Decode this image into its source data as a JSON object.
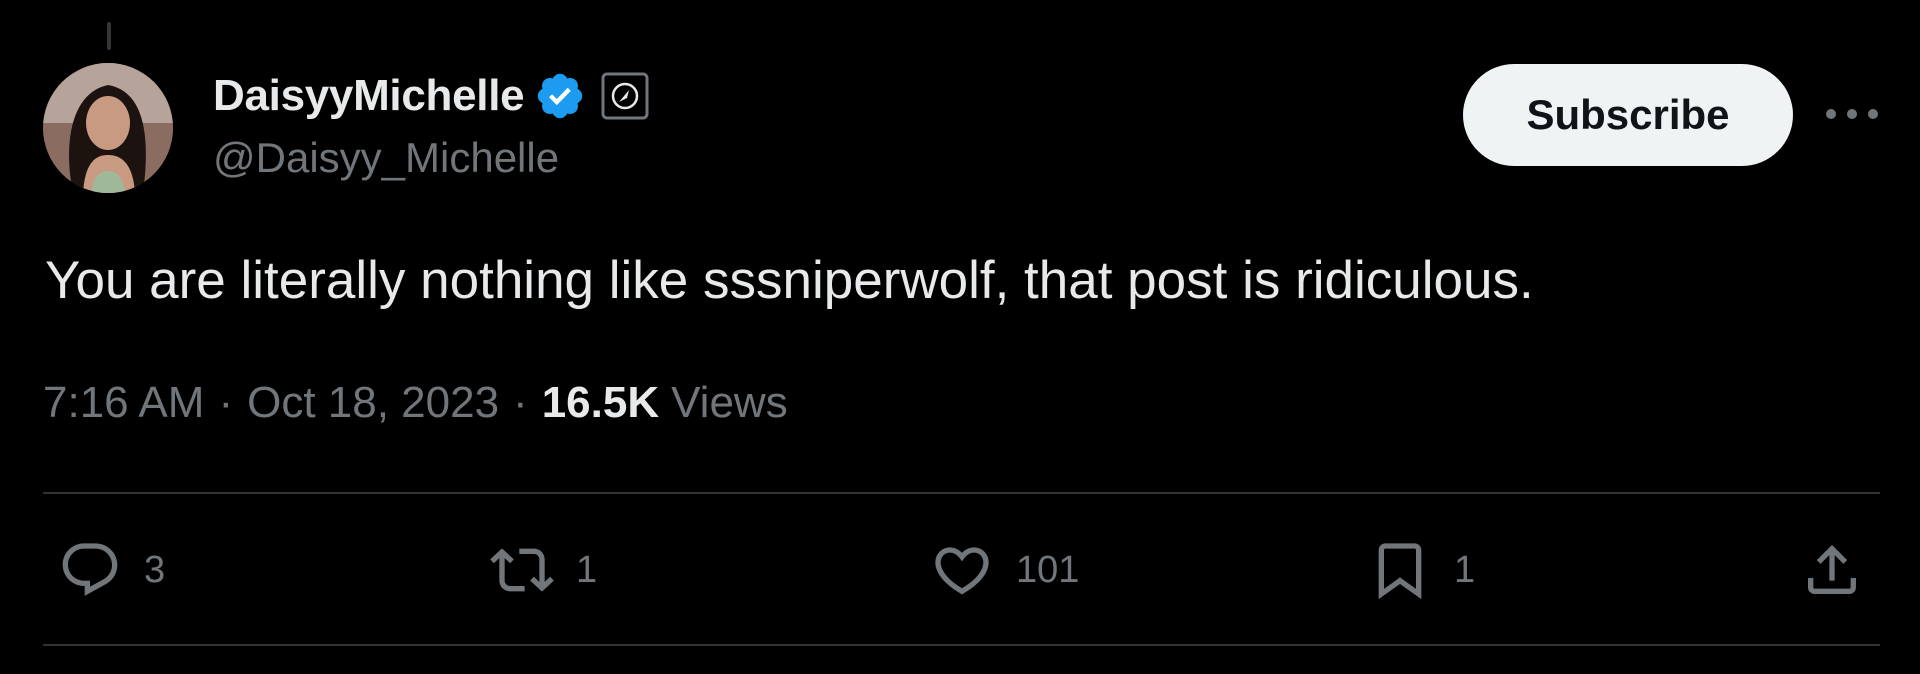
{
  "author": {
    "display_name": "DaisyyMichelle",
    "handle": "@Daisyy_Michelle",
    "verified_icon": "verified-badge-icon",
    "affiliate_icon": "affiliate-badge-icon"
  },
  "header": {
    "subscribe_label": "Subscribe",
    "more_icon": "more-horizontal-icon"
  },
  "tweet": {
    "text": "You are literally nothing like sssniperwolf, that post is ridiculous.",
    "time": "7:16 AM",
    "separator": "·",
    "date": "Oct 18, 2023",
    "views_count": "16.5K",
    "views_label": "Views"
  },
  "actions": {
    "reply": {
      "icon": "reply-icon",
      "count": "3"
    },
    "repost": {
      "icon": "repost-icon",
      "count": "1"
    },
    "like": {
      "icon": "heart-icon",
      "count": "101"
    },
    "bookmark": {
      "icon": "bookmark-icon",
      "count": "1"
    },
    "share": {
      "icon": "share-icon"
    }
  },
  "colors": {
    "background": "#000000",
    "text_primary": "#e7e9ea",
    "text_secondary": "#71767b",
    "verified_blue": "#1d9bf0",
    "divider": "#2f3336",
    "subscribe_bg": "#eff3f4"
  }
}
